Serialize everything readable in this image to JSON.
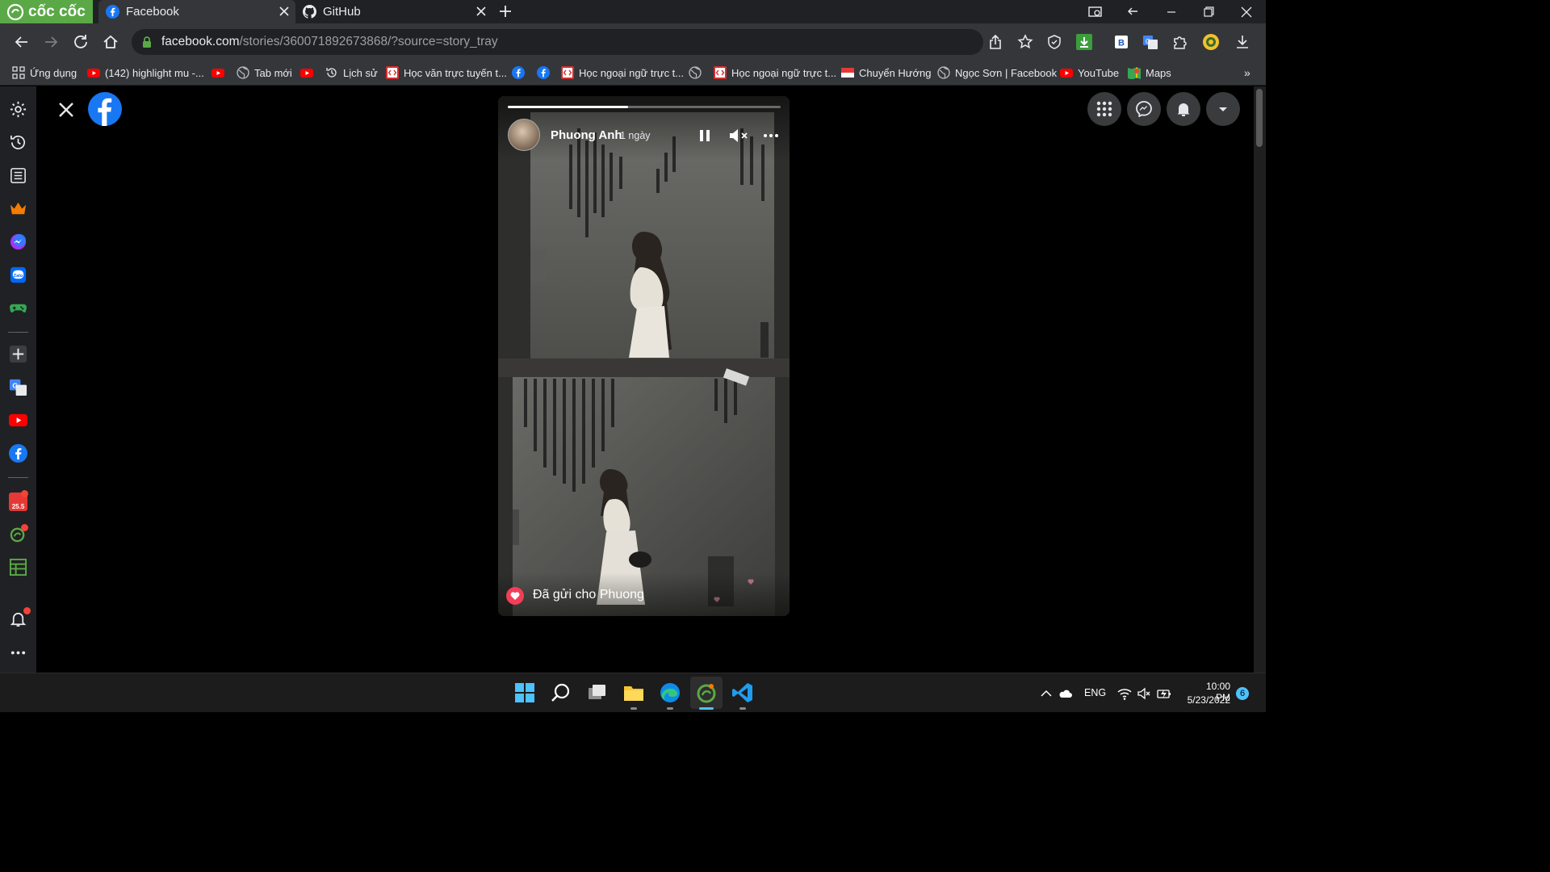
{
  "browser": {
    "brand": "cốc cốc",
    "tabs": [
      {
        "label": "Facebook",
        "icon": "facebook-icon",
        "active": true
      },
      {
        "label": "GitHub",
        "icon": "github-icon",
        "active": false
      }
    ],
    "url": {
      "host": "facebook.com",
      "path": "/stories/360071892673868/?source=story_tray"
    },
    "toolbar_extensions": [
      "share-icon",
      "star-icon",
      "shield-icon",
      "download-green-icon",
      "b-extension-icon",
      "translate-icon",
      "puzzle-icon",
      "coin-icon",
      "download-icon"
    ]
  },
  "bookmarks": [
    {
      "label": "Ứng dụng",
      "icon": "apps-grid-icon"
    },
    {
      "label": "(142) highlight mu -...",
      "icon": "youtube-icon"
    },
    {
      "label": "",
      "icon": "youtube-icon"
    },
    {
      "label": "Tab mới",
      "icon": "globe-icon"
    },
    {
      "label": "",
      "icon": "youtube-icon"
    },
    {
      "label": "Lịch sử",
      "icon": "history-icon"
    },
    {
      "label": "Học văn trực tuyến t...",
      "icon": "code-icon"
    },
    {
      "label": "",
      "icon": "facebook-icon"
    },
    {
      "label": "",
      "icon": "facebook-icon"
    },
    {
      "label": "Học ngoại ngữ trực t...",
      "icon": "code-icon"
    },
    {
      "label": "",
      "icon": "globe-icon"
    },
    {
      "label": "Học ngoại ngữ trực t...",
      "icon": "code-icon"
    },
    {
      "label": "Chuyển Hướng",
      "icon": "flag-icon"
    },
    {
      "label": "Ngọc Sơn | Facebook",
      "icon": "globe-icon"
    },
    {
      "label": "YouTube",
      "icon": "youtube-icon"
    },
    {
      "label": "Maps",
      "icon": "maps-icon"
    }
  ],
  "bookmarks_overflow": "»",
  "sidebar": {
    "items": [
      "settings-icon",
      "history-icon",
      "reading-list-icon",
      "crown-icon",
      "messenger-icon",
      "zalo-icon",
      "gamepad-icon",
      "add-icon",
      "translate-icon",
      "youtube-icon",
      "facebook-icon",
      "calendar-icon",
      "leaf-icon",
      "spreadsheet-icon",
      "bell-icon",
      "more-icon"
    ],
    "calendar_badge": "25.5"
  },
  "story": {
    "author": "Phuong Anh",
    "time": "1 ngày",
    "progress": 0.44,
    "reply_status": "Đã gửi cho Phuong"
  },
  "fb_header_buttons": [
    "menu-grid-icon",
    "messenger-icon",
    "notifications-icon",
    "account-dropdown-icon"
  ],
  "taskbar": {
    "apps": [
      "windows-start-icon",
      "search-icon",
      "task-view-icon",
      "file-explorer-icon",
      "edge-icon",
      "coccoc-icon",
      "vscode-icon"
    ],
    "language": "ENG",
    "time": "10:00 PM",
    "date": "5/23/2022",
    "notifications": "6"
  },
  "colors": {
    "accent_green": "#5aa946",
    "facebook_blue": "#1877f2",
    "heart_red": "#f33e58"
  }
}
